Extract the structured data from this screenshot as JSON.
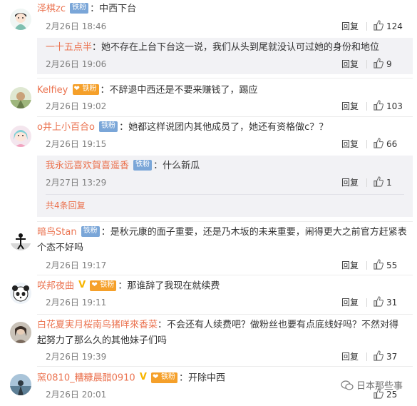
{
  "comments": [
    {
      "name": "泽棋zc",
      "badge": "铁粉",
      "text": "中西下台",
      "time": "2月26日 18:46",
      "reply": "回复",
      "likes": "124"
    },
    {
      "name": "一十五点半",
      "text": "她不存在上台下台这一说，我们从头到尾就没认可过她的身份和地位",
      "time": "2月26日 19:06",
      "reply": "回复",
      "likes": "9"
    },
    {
      "name": "Kelfiey",
      "badge": "铁粉",
      "text": "不辞退中西还是不要来赚钱了，踢应",
      "time": "2月26日 19:02",
      "reply": "回复",
      "likes": "103"
    },
    {
      "name": "o井上小百合o",
      "badge": "铁粉",
      "text": "她都这样说团内其他成员了，她还有资格做c？？",
      "time": "2月26日 19:15",
      "reply": "回复",
      "likes": "66"
    },
    {
      "name": "我永远喜欢賀喜遥香",
      "badge": "铁粉",
      "text": "什么新瓜",
      "time": "2月27日 13:29",
      "reply": "回复",
      "likes": "1",
      "more": "共4条回复"
    },
    {
      "name": "暗鸟Stan",
      "badge": "铁粉",
      "text": "是秋元康的面子重要，还是乃木坂的未来重要，闹得更大之前官方赶紧表个态不好吗",
      "time": "2月26日 19:17",
      "reply": "回复",
      "likes": "55"
    },
    {
      "name": "咲邦夜曲",
      "badge": "铁粉",
      "text": "那谁辞了我现在就续费",
      "time": "2月26日 19:11",
      "reply": "回复",
      "likes": "31"
    },
    {
      "name": "白花夏実月桜南鸟猪咩來香菜",
      "text": "不会还有人续费吧？做粉丝也要有点底线好吗？不然对得起努力了那么久的其他妹子们吗",
      "time": "2月26日 19:39",
      "reply": "回复",
      "likes": "37"
    },
    {
      "name": "窯0810_糟糠晨醋0910",
      "badge": "铁粉",
      "text": "开除中西",
      "time": "2月26日 20:01",
      "reply": "回复",
      "likes": "25"
    }
  ],
  "watermark": "日本那些事",
  "colors": {
    "name": "#eb7350",
    "badge_blue": "#7aa6d8",
    "badge_orange": "#f5a02a",
    "vip": "#f7b500"
  }
}
